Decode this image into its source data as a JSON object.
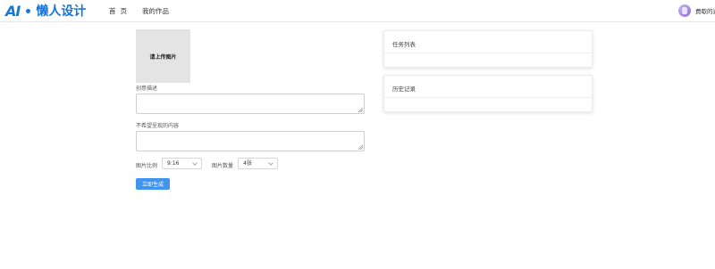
{
  "header": {
    "logo_ai": "AI",
    "logo_text": "懒人设计",
    "nav": {
      "home": "首页",
      "works": "我的作品"
    },
    "user_name": "费歇的滤"
  },
  "upload": {
    "label": "请上传图片"
  },
  "form": {
    "creative_label": "创意描述",
    "creative_value": "",
    "exclude_label": "不希望呈现的内容",
    "exclude_value": "",
    "ratio_label": "图片比例",
    "ratio_value": "9:16",
    "count_label": "图片数量",
    "count_value": "4张",
    "generate_label": "立即生成"
  },
  "panels": {
    "tasks_title": "任务列表",
    "history_title": "历史记录"
  },
  "colors": {
    "brand": "#1677d9",
    "primary_button": "#3f95ef"
  }
}
